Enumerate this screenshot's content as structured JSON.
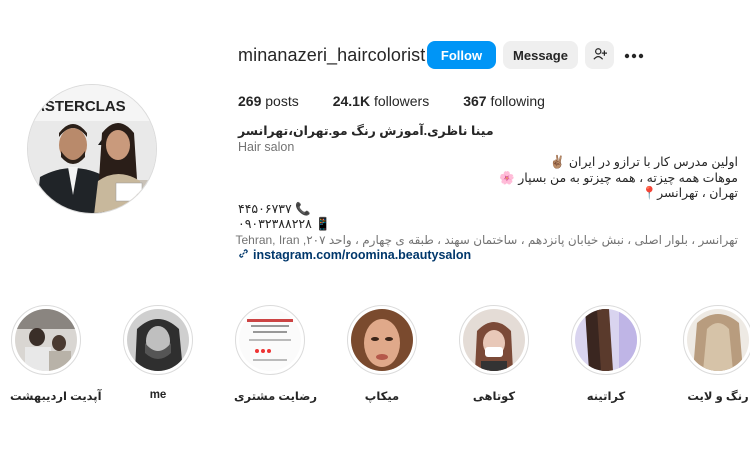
{
  "profile": {
    "username": "minanazeri_haircolorist",
    "avatar_banner_text": "ASTERCLAS",
    "buttons": {
      "follow": "Follow",
      "message": "Message"
    },
    "icons": {
      "suggest": "person-add-icon",
      "more": "more-horizontal-icon",
      "link": "link-icon"
    },
    "stats": {
      "posts_count": "269",
      "posts_label": " posts",
      "followers_count": "24.1K",
      "followers_label": " followers",
      "following_count": "367",
      "following_label": " following"
    },
    "bio": {
      "name": "مینا ناظری.آموزش رنگ مو.تهران،تهرانسر",
      "category": "Hair salon",
      "line1": "اولین مدرس کار با ترازو در ایران ✌🏽",
      "line2": "موهات همه چیزته ، همه چیزتو به من بسپار 🌸",
      "line3": "تهران ، تهرانسر📍",
      "line4": "۴۴۵۰۶۷۳۷ 📞",
      "line5": "۰۹۰۳۲۳۸۸۲۲۸ 📱",
      "address": "تهرانسر ، بلوار اصلی ، نبش خیابان پانزدهم ، ساختمان سهند ، طبقه ی چهارم ، واحد ۲۰۷, Tehran, Iran",
      "link": "instagram.com/roomina.beautysalon"
    }
  },
  "highlights": [
    {
      "label": "آپدیت اردیبهشت"
    },
    {
      "label": "me"
    },
    {
      "label": "رضایت مشتری"
    },
    {
      "label": "میکاپ"
    },
    {
      "label": "کوتاهی"
    },
    {
      "label": "کراتینه"
    },
    {
      "label": "رنگ و لایت"
    }
  ],
  "colors": {
    "accent": "#0095f6",
    "secondary_button": "#efefef",
    "link": "#00376b",
    "muted": "#737373"
  }
}
